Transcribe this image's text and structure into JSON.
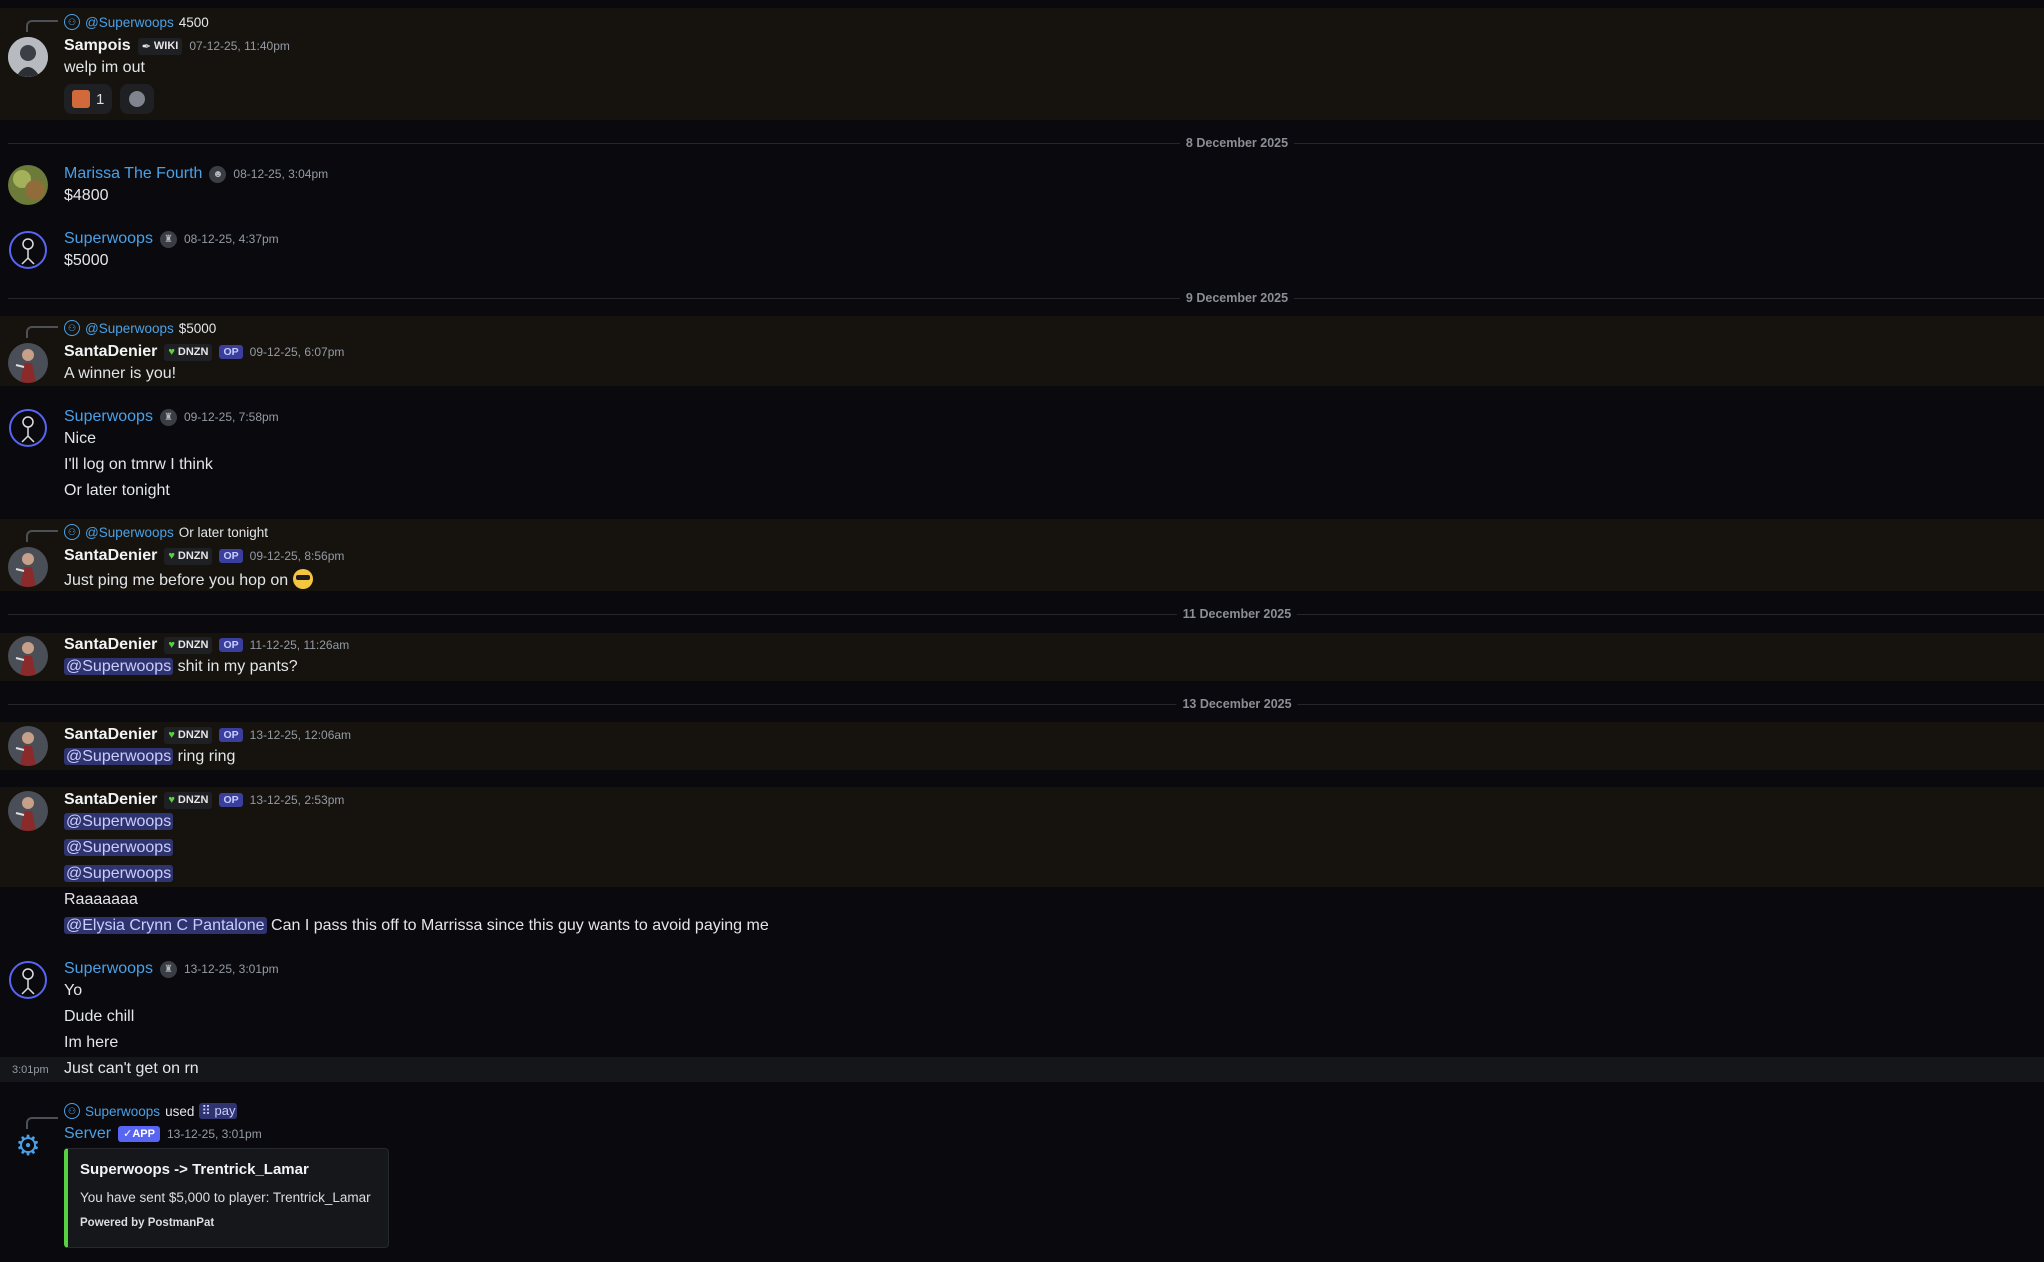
{
  "dividers": [
    "8 December 2025",
    "9 December 2025",
    "11 December 2025",
    "13 December 2025"
  ],
  "messages": [
    {
      "reply_user": "@Superwoops",
      "reply_text": "4500",
      "user": "Sampois",
      "badge": "WIKI",
      "time": "07-12-25, 11:40pm",
      "lines": [
        "welp im out"
      ],
      "reaction_count": "1"
    },
    {
      "user": "Marissa The Fourth",
      "time": "08-12-25, 3:04pm",
      "lines": [
        "$4800"
      ]
    },
    {
      "user": "Superwoops",
      "time": "08-12-25, 4:37pm",
      "lines": [
        "$5000"
      ]
    },
    {
      "reply_user": "@Superwoops",
      "reply_text": "$5000",
      "user": "SantaDenier",
      "badge": "DNZN",
      "op": "OP",
      "time": "09-12-25, 6:07pm",
      "lines": [
        "A winner is you!"
      ]
    },
    {
      "user": "Superwoops",
      "time": "09-12-25, 7:58pm",
      "lines": [
        "Nice",
        "I'll log on tmrw I think",
        "Or later tonight"
      ]
    },
    {
      "reply_user": "@Superwoops",
      "reply_text": "Or later tonight",
      "user": "SantaDenier",
      "badge": "DNZN",
      "op": "OP",
      "time": "09-12-25, 8:56pm",
      "lines": [
        "Just ping me before you hop on"
      ]
    },
    {
      "user": "SantaDenier",
      "badge": "DNZN",
      "op": "OP",
      "time": "11-12-25, 11:26am",
      "mention": "@Superwoops",
      "lines": [
        "shit in my pants?"
      ]
    },
    {
      "user": "SantaDenier",
      "badge": "DNZN",
      "op": "OP",
      "time": "13-12-25, 12:06am",
      "mention": "@Superwoops",
      "lines": [
        "ring ring"
      ]
    },
    {
      "user": "SantaDenier",
      "badge": "DNZN",
      "op": "OP",
      "time": "13-12-25, 2:53pm",
      "mentions": [
        "@Superwoops",
        "@Superwoops",
        "@Superwoops"
      ],
      "lines": [
        "Raaaaaaa"
      ],
      "mention2": "@Elysia Crynn C Pantalone",
      "line2": "Can I pass this off to Marrissa since this guy wants to avoid paying me"
    },
    {
      "user": "Superwoops",
      "time": "13-12-25, 3:01pm",
      "lines": [
        "Yo",
        "Dude chill",
        "Im here"
      ],
      "hover_time": "3:01pm",
      "hover_line": "Just can't get on rn"
    },
    {
      "cmd_user": "Superwoops",
      "cmd_used": "used",
      "cmd_name": "pay",
      "user": "Server",
      "app": "APP",
      "time": "13-12-25, 3:01pm",
      "embed": {
        "title": "Superwoops -> Trentrick_Lamar",
        "desc": "You have sent $5,000 to player: Trentrick_Lamar",
        "footer": "Powered by PostmanPat",
        "accent": "#57d13f"
      }
    }
  ]
}
